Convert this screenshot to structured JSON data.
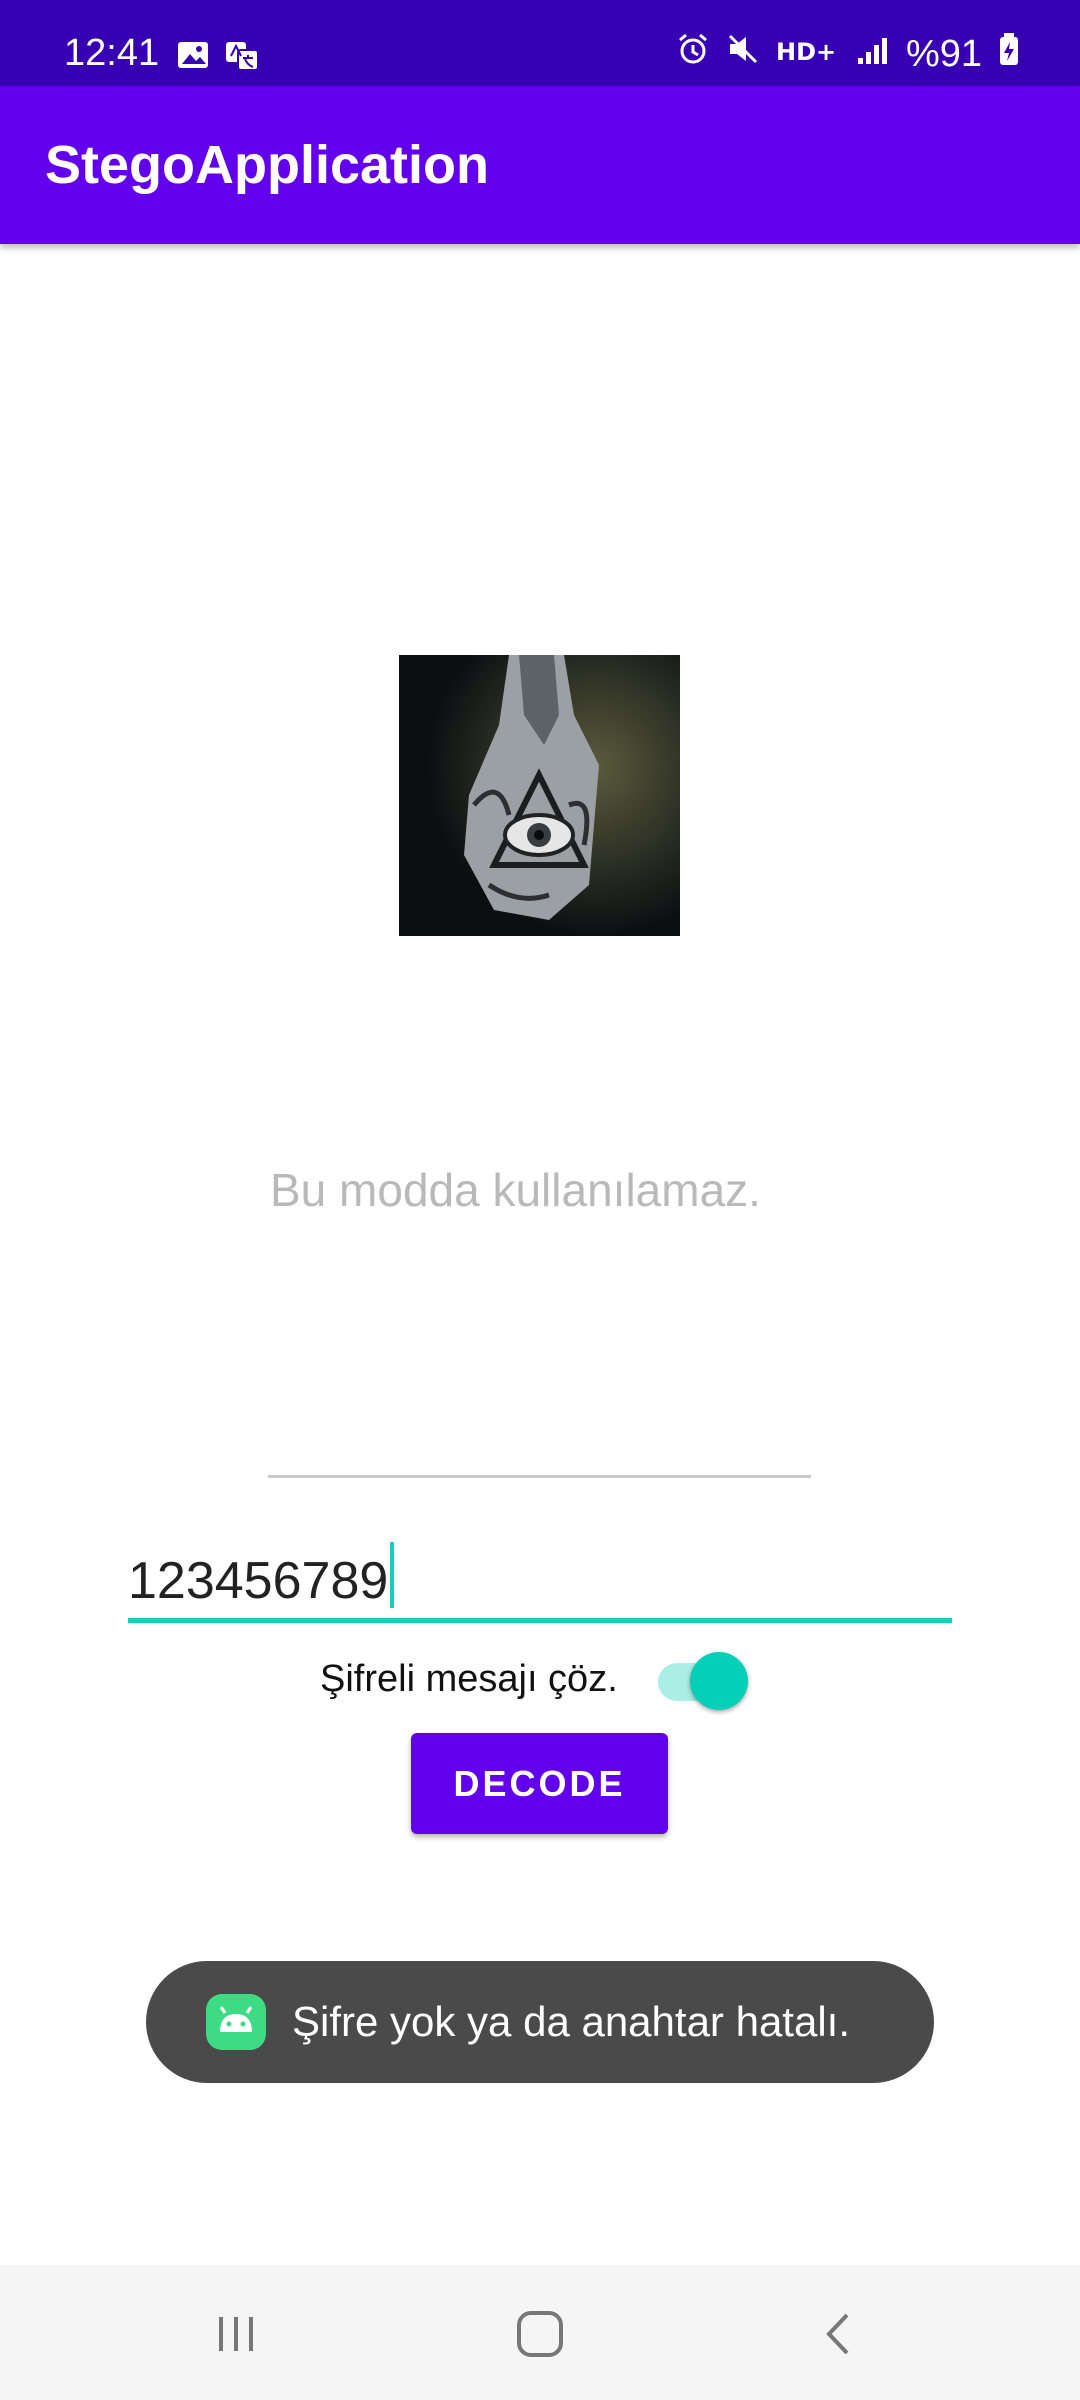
{
  "status_bar": {
    "time": "12:41",
    "left_icons": [
      "image-icon",
      "translate-icon"
    ],
    "right_icons": [
      "alarm-icon",
      "mute-icon",
      "hd-plus-icon",
      "signal-icon"
    ],
    "battery": "%91"
  },
  "app_bar": {
    "title": "StegoApplication"
  },
  "image": {
    "alt": "hand tattoo with eye in triangle"
  },
  "message_field": {
    "text": "Bu modda kullanılamaz."
  },
  "key_field": {
    "value": "123456789"
  },
  "toggle": {
    "label": "Şifreli mesajı çöz.",
    "state": "on"
  },
  "decode_button": {
    "label": "DECODE"
  },
  "toast": {
    "message": "Şifre yok ya da anahtar hatalı."
  },
  "nav_bar": {
    "buttons": [
      "recent-apps-icon",
      "home-icon",
      "back-icon"
    ]
  },
  "colors": {
    "primary": "#6200ee",
    "primary_dark": "#3700b3",
    "accent": "#18cdb8"
  }
}
